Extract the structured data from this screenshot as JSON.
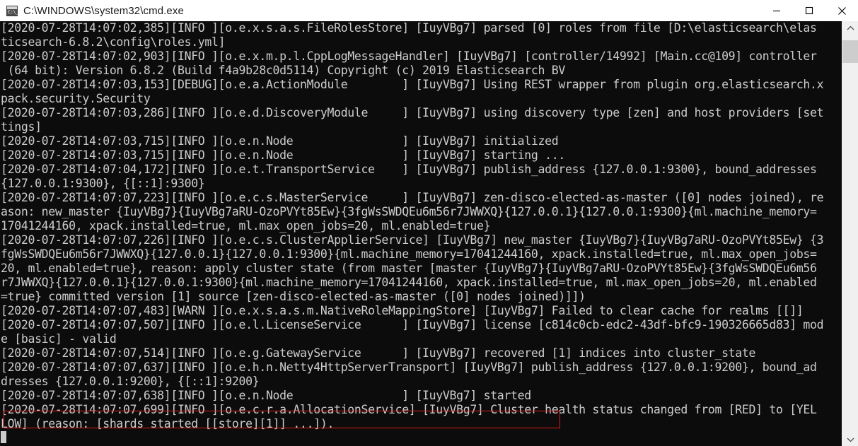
{
  "window": {
    "title": "C:\\WINDOWS\\system32\\cmd.exe",
    "icon": "cmd-console-icon",
    "minimize_label": "Minimize",
    "maximize_label": "Maximize",
    "close_label": "Close",
    "background_color": "#0c0c0c",
    "text_color": "#cccccc",
    "titlebar_color": "#ffffff"
  },
  "annotation": {
    "name": "red-highlight-box",
    "color": "#e11b1b",
    "target_text": "[2020-07-28T14:07:07,638][INFO ][o.e.n.Node               ] [IuyVBg7] started"
  },
  "scrollbar": {
    "up_arrow": "⌃",
    "down_arrow": "⌄",
    "thumb_position": "near-top"
  },
  "console": {
    "cursor_visible": true,
    "lines": [
      "[2020-07-28T14:07:02,385][INFO ][o.e.x.s.a.s.FileRolesStore] [IuyVBg7] parsed [0] roles from file [D:\\elasticsearch\\elas",
      "ticsearch-6.8.2\\config\\roles.yml]",
      "[2020-07-28T14:07:02,903][INFO ][o.e.x.m.p.l.CppLogMessageHandler] [IuyVBg7] [controller/14992] [Main.cc@109] controller",
      " (64 bit): Version 6.8.2 (Build f4a9b28c0d5114) Copyright (c) 2019 Elasticsearch BV",
      "[2020-07-28T14:07:03,153][DEBUG][o.e.a.ActionModule        ] [IuyVBg7] Using REST wrapper from plugin org.elasticsearch.x",
      "pack.security.Security",
      "[2020-07-28T14:07:03,286][INFO ][o.e.d.DiscoveryModule     ] [IuyVBg7] using discovery type [zen] and host providers [set",
      "tings]",
      "[2020-07-28T14:07:03,715][INFO ][o.e.n.Node                ] [IuyVBg7] initialized",
      "[2020-07-28T14:07:03,715][INFO ][o.e.n.Node                ] [IuyVBg7] starting ...",
      "[2020-07-28T14:07:04,172][INFO ][o.e.t.TransportService    ] [IuyVBg7] publish_address {127.0.0.1:9300}, bound_addresses",
      "{127.0.0.1:9300}, {[::1]:9300}",
      "[2020-07-28T14:07:07,223][INFO ][o.e.c.s.MasterService     ] [IuyVBg7] zen-disco-elected-as-master ([0] nodes joined), re",
      "ason: new_master {IuyVBg7}{IuyVBg7aRU-OzoPVYt85Ew}{3fgWsSWDQEu6m56r7JWWXQ}{127.0.0.1}{127.0.0.1:9300}{ml.machine_memory=",
      "17041244160, xpack.installed=true, ml.max_open_jobs=20, ml.enabled=true}",
      "[2020-07-28T14:07:07,226][INFO ][o.e.c.s.ClusterApplierService] [IuyVBg7] new_master {IuyVBg7}{IuyVBg7aRU-OzoPVYt85Ew} {3",
      "fgWsSWDQEu6m56r7JWWXQ}{127.0.0.1}{127.0.0.1:9300}{ml.machine_memory=17041244160, xpack.installed=true, ml.max_open_jobs=",
      "20, ml.enabled=true}, reason: apply cluster state (from master [master {IuyVBg7}{IuyVBg7aRU-OzoPVYt85Ew}{3fgWsSWDQEu6m56",
      "r7JWWXQ}{127.0.0.1}{127.0.0.1:9300}{ml.machine_memory=17041244160, xpack.installed=true, ml.max_open_jobs=20, ml.enabled",
      "=true} committed version [1] source [zen-disco-elected-as-master ([0] nodes joined)]])",
      "[2020-07-28T14:07:07,483][WARN ][o.e.x.s.a.s.m.NativeRoleMappingStore] [IuyVBg7] Failed to clear cache for realms [[]]",
      "[2020-07-28T14:07:07,507][INFO ][o.e.l.LicenseService      ] [IuyVBg7] license [c814c0cb-edc2-43df-bfc9-190326665d83] mod",
      "e [basic] - valid",
      "[2020-07-28T14:07:07,514][INFO ][o.e.g.GatewayService      ] [IuyVBg7] recovered [1] indices into cluster_state",
      "[2020-07-28T14:07:07,637][INFO ][o.e.h.n.Netty4HttpServerTransport] [IuyVBg7] publish_address {127.0.0.1:9200}, bound_ad",
      "dresses {127.0.0.1:9200}, {[::1]:9200}",
      "[2020-07-28T14:07:07,638][INFO ][o.e.n.Node                ] [IuyVBg7] started",
      "[2020-07-28T14:07:07,699][INFO ][o.e.c.r.a.AllocationService] [IuyVBg7] Cluster health status changed from [RED] to [YEL",
      "LOW] (reason: [shards started [[store][1]] ...])."
    ]
  }
}
